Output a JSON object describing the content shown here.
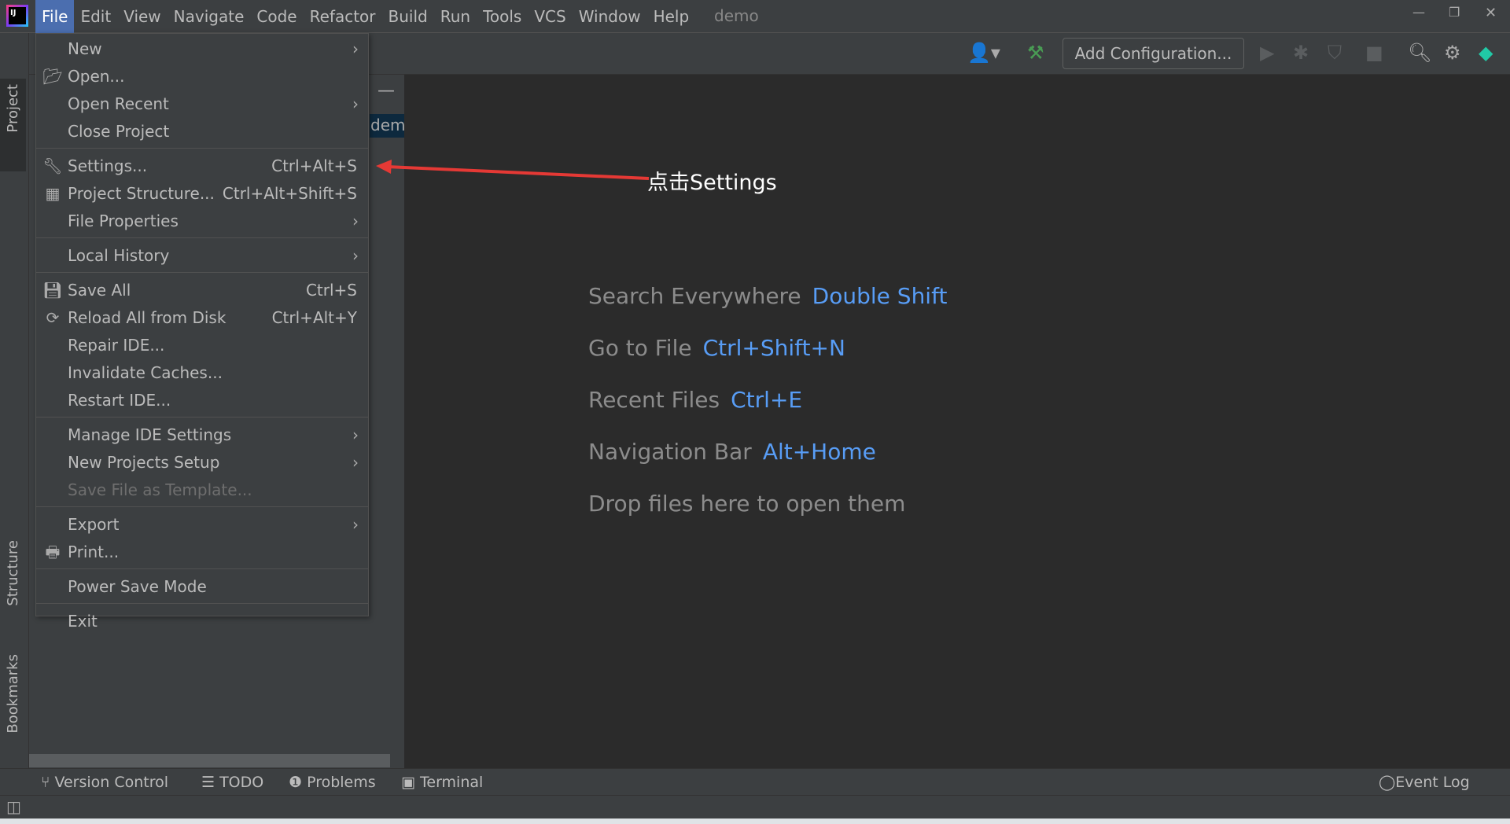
{
  "menubar": {
    "items": [
      "File",
      "Edit",
      "View",
      "Navigate",
      "Code",
      "Refactor",
      "Build",
      "Run",
      "Tools",
      "VCS",
      "Window",
      "Help"
    ],
    "project": "demo"
  },
  "toolbar": {
    "add_configuration": "Add Configuration..."
  },
  "side_tabs": {
    "project": "Project",
    "structure": "Structure",
    "bookmarks": "Bookmarks"
  },
  "project_panel": {
    "truncated_item": "dem"
  },
  "file_menu": {
    "new": "New",
    "open": "Open...",
    "open_recent": "Open Recent",
    "close_project": "Close Project",
    "settings": "Settings...",
    "settings_sc": "Ctrl+Alt+S",
    "project_structure": "Project Structure...",
    "project_structure_sc": "Ctrl+Alt+Shift+S",
    "file_properties": "File Properties",
    "local_history": "Local History",
    "save_all": "Save All",
    "save_all_sc": "Ctrl+S",
    "reload": "Reload All from Disk",
    "reload_sc": "Ctrl+Alt+Y",
    "repair": "Repair IDE...",
    "invalidate": "Invalidate Caches...",
    "restart": "Restart IDE...",
    "manage": "Manage IDE Settings",
    "new_projects_setup": "New Projects Setup",
    "save_template": "Save File as Template...",
    "export": "Export",
    "print": "Print...",
    "power_save": "Power Save Mode",
    "exit": "Exit"
  },
  "welcome": [
    {
      "label": "Search Everywhere",
      "key": "Double Shift"
    },
    {
      "label": "Go to File",
      "key": "Ctrl+Shift+N"
    },
    {
      "label": "Recent Files",
      "key": "Ctrl+E"
    },
    {
      "label": "Navigation Bar",
      "key": "Alt+Home"
    },
    {
      "label": "Drop files here to open them",
      "key": ""
    }
  ],
  "annotation": {
    "text": "点击Settings",
    "color": "#e53935"
  },
  "bottom": {
    "version_control": "Version Control",
    "todo": "TODO",
    "problems": "Problems",
    "terminal": "Terminal",
    "event_log": "Event Log"
  },
  "colors": {
    "accent": "#4b6eaf",
    "link": "#589df6",
    "build": "#499c54"
  }
}
